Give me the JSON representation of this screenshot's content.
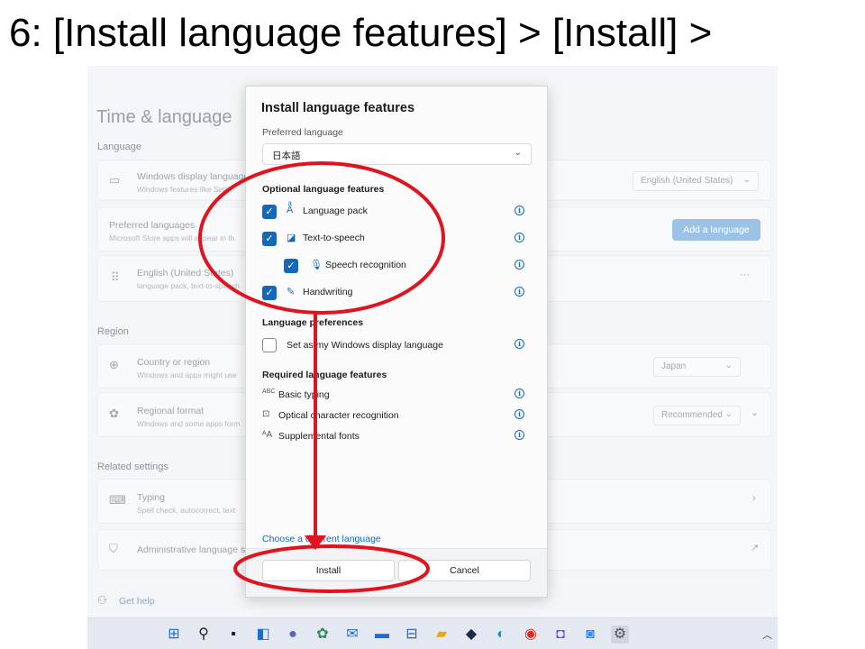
{
  "slide": {
    "title": "6: [Install language features] > [Install] >"
  },
  "settings": {
    "title": "Time & language",
    "sections": {
      "language": "Language",
      "region": "Region",
      "related": "Related settings"
    },
    "display_language": {
      "title": "Windows display language",
      "subtitle": "Windows features like Setti",
      "value": "English (United States)"
    },
    "preferred_languages": {
      "title": "Preferred languages",
      "subtitle": "Microsoft Store apps will appear in th",
      "button": "Add a language"
    },
    "english_item": {
      "title": "English (United States)",
      "subtitle": "language pack, text-to-speech",
      "more": "···"
    },
    "country": {
      "title": "Country or region",
      "subtitle": "Windows and apps might use",
      "value": "Japan"
    },
    "regional_format": {
      "title": "Regional format",
      "subtitle": "Windows and some apps form",
      "value": "Recommended"
    },
    "typing": {
      "title": "Typing",
      "subtitle": "Spell check, autocorrect, text"
    },
    "admin_language": {
      "title": "Administrative language se"
    },
    "get_help": "Get help"
  },
  "dialog": {
    "title": "Install language features",
    "preferred_label": "Preferred language",
    "preferred_value": "日本語",
    "optional_heading": "Optional language features",
    "optional_items": [
      {
        "label": "Language pack",
        "checked": true
      },
      {
        "label": "Text-to-speech",
        "checked": true
      },
      {
        "label": "Speech recognition",
        "checked": true
      },
      {
        "label": "Handwriting",
        "checked": true
      }
    ],
    "preferences_heading": "Language preferences",
    "preferences_item": {
      "label": "Set as my Windows display language",
      "checked": false
    },
    "required_heading": "Required language features",
    "required_items": [
      {
        "label": "Basic typing",
        "icon": "ABC"
      },
      {
        "label": "Optical character recognition"
      },
      {
        "label": "Supplemental fonts"
      }
    ],
    "choose_link": "Choose a different language",
    "install_button": "Install",
    "cancel_button": "Cancel"
  },
  "colors": {
    "accent": "#1468b8",
    "annotation": "#e0141e"
  }
}
